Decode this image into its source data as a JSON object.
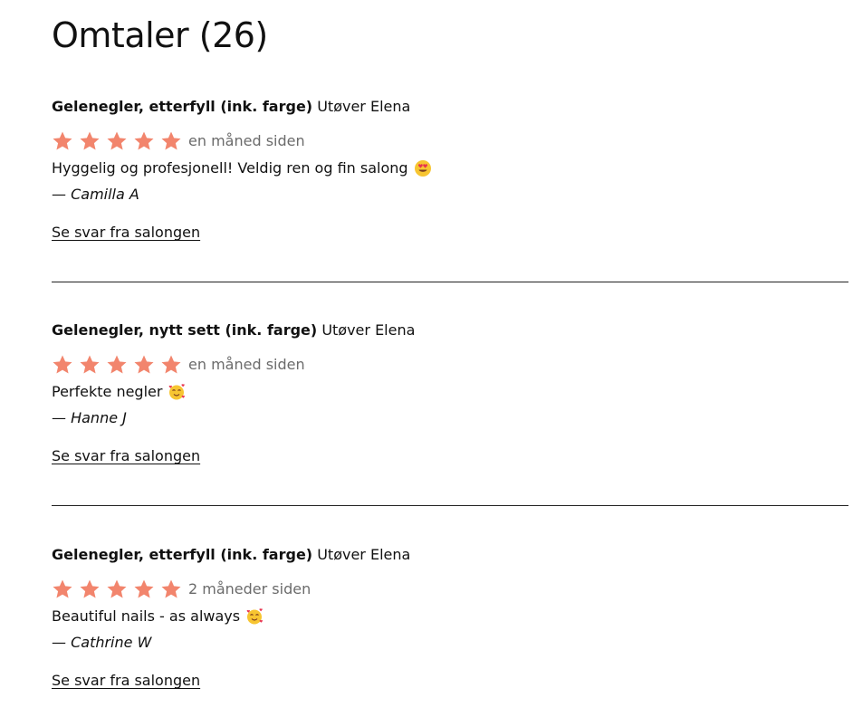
{
  "page": {
    "title": "Omtaler (26)"
  },
  "colors": {
    "star": "#f2856d",
    "muted_text": "#6b6b6b",
    "text": "#111111",
    "divider": "#222222"
  },
  "reviews": [
    {
      "service": "Gelenegler, etterfyll (ink. farge)",
      "performer": "Utøver Elena",
      "rating": 5,
      "time_ago": "en måned siden",
      "comment": "Hyggelig og profesjonell! Veldig ren og fin salong",
      "emoji": "heart-eyes-emoji-icon",
      "author": "— Camilla A",
      "reply_link": "Se svar fra salongen"
    },
    {
      "service": "Gelenegler, nytt sett (ink. farge)",
      "performer": "Utøver Elena",
      "rating": 5,
      "time_ago": "en måned siden",
      "comment": "Perfekte negler",
      "emoji": "smiling-face-with-hearts-emoji-icon",
      "author": "— Hanne J",
      "reply_link": "Se svar fra salongen"
    },
    {
      "service": "Gelenegler, etterfyll (ink. farge)",
      "performer": "Utøver Elena",
      "rating": 5,
      "time_ago": "2 måneder siden",
      "comment": "Beautiful nails - as always",
      "emoji": "smiling-face-with-hearts-emoji-icon",
      "author": "— Cathrine W",
      "reply_link": "Se svar fra salongen"
    }
  ]
}
